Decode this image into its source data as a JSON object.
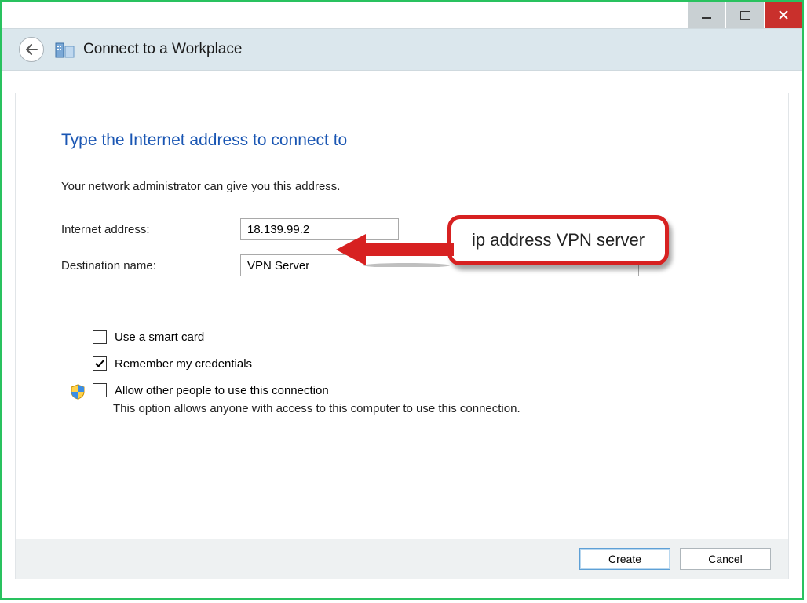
{
  "header": {
    "title": "Connect to a Workplace"
  },
  "page": {
    "title": "Type the Internet address to connect to",
    "subtext": "Your network administrator can give you this address."
  },
  "fields": {
    "internet_address": {
      "label": "Internet address:",
      "value": "18.139.99.2"
    },
    "destination_name": {
      "label": "Destination name:",
      "value": "VPN Server"
    }
  },
  "options": {
    "smart_card": {
      "label": "Use a smart card",
      "checked": false
    },
    "remember": {
      "label": "Remember my credentials",
      "checked": true
    },
    "allow_others": {
      "label": "Allow other people to use this connection",
      "desc": "This option allows anyone with access to this computer to use this connection.",
      "checked": false
    }
  },
  "buttons": {
    "create": "Create",
    "cancel": "Cancel"
  },
  "annotation": {
    "text": "ip address VPN server"
  }
}
